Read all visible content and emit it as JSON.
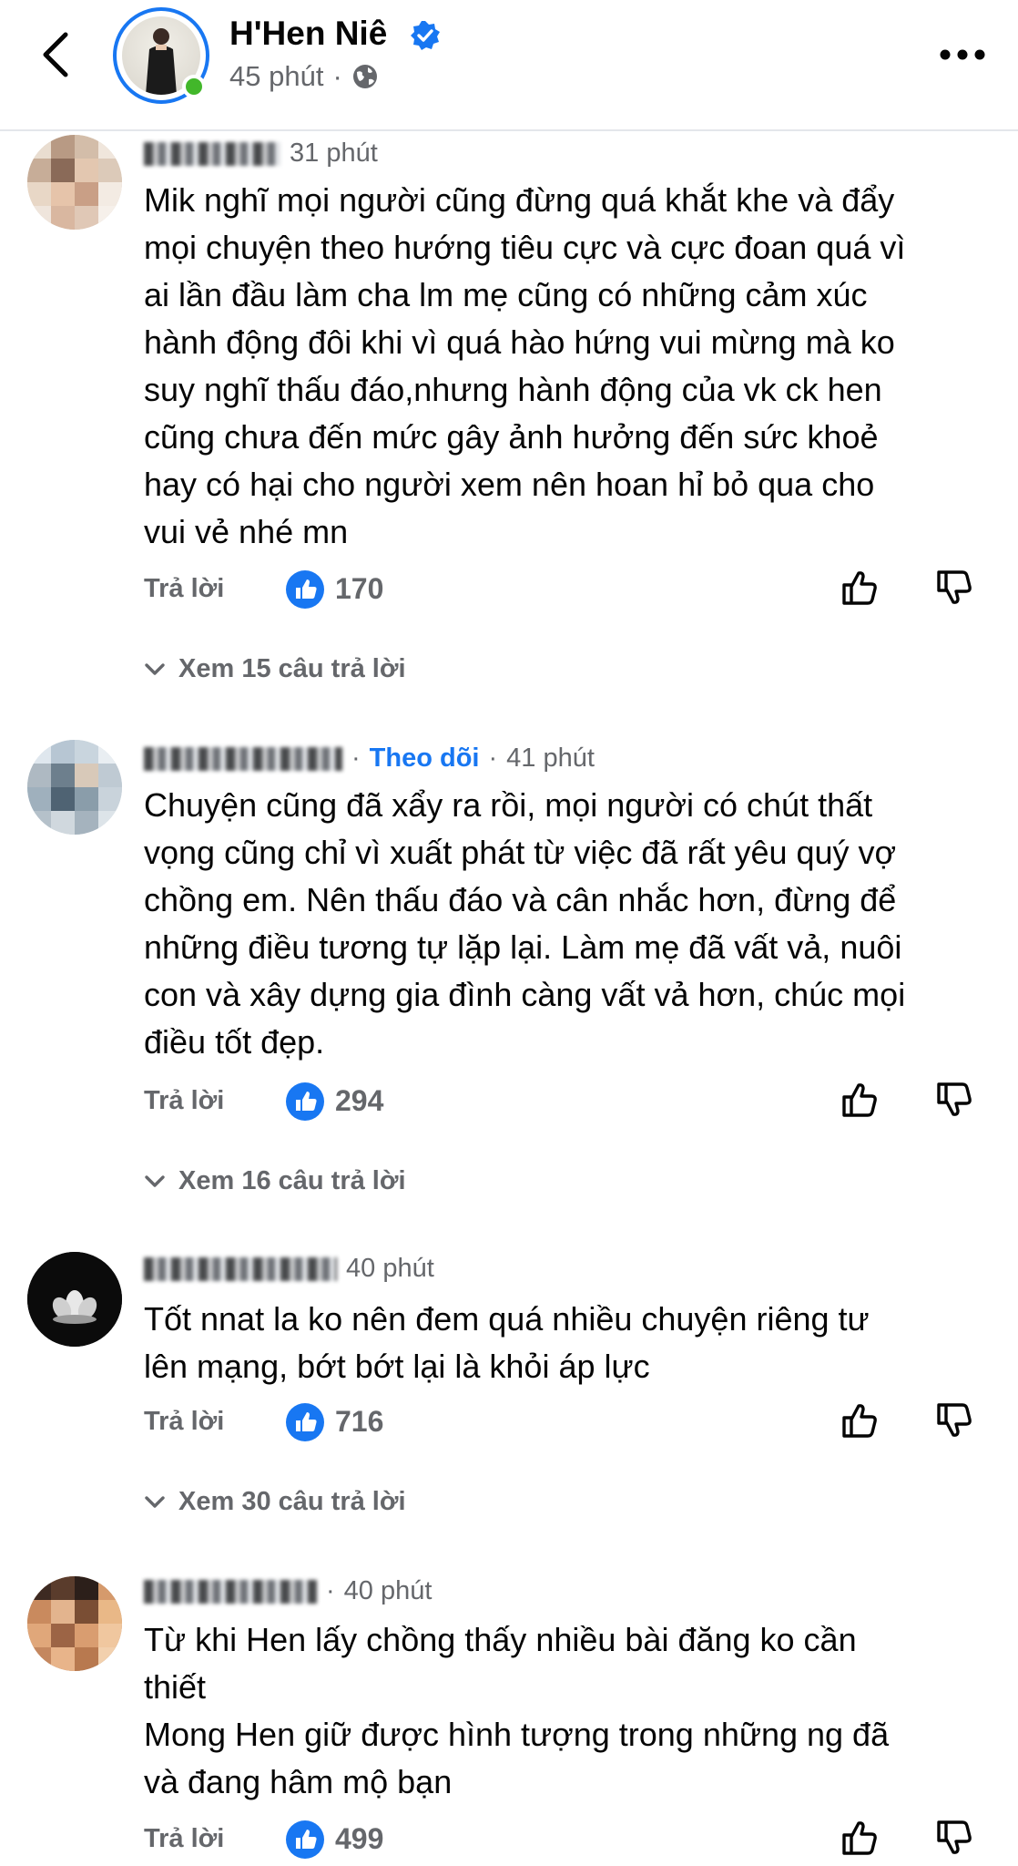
{
  "header": {
    "page_name": "H'Hen Niê",
    "time": "45 phút",
    "separator": "·",
    "icons": {
      "back": "chevron-left-icon",
      "verified": "verified-badge-icon",
      "audience": "globe-icon",
      "more": "more-horizontal-icon"
    }
  },
  "colors": {
    "accent": "#1877f2",
    "secondary_text": "#65676b",
    "online": "#42b72a",
    "text": "#050505"
  },
  "comments": [
    {
      "time": "31 phút",
      "text": "Mik nghĩ mọi người cũng đừng quá khắt khe và đẩy\nmọi chuyện theo hướng tiêu cực và cực đoan quá vì\nai lần đầu làm cha lm mẹ cũng có những cảm xúc\nhành động đôi khi vì quá hào hứng vui mừng mà ko\nsuy nghĩ thấu đáo,nhưng hành động của vk ck hen\ncũng chưa đến mức gây ảnh hưởng đến sức khoẻ\nhay có hại cho người xem nên hoan hỉ bỏ qua cho\nvui vẻ nhé mn",
      "reply_label": "Trả lời",
      "likes": "170",
      "view_replies": "Xem 15 câu trả lời"
    },
    {
      "follow_label": "Theo dõi",
      "separator": "·",
      "time": "41 phút",
      "text": "Chuyện cũng đã xẩy ra rồi, mọi người có chút thất\nvọng cũng chỉ vì xuất phát từ việc đã rất yêu quý vợ\nchồng em. Nên thấu đáo và cân nhắc hơn, đừng để\nnhững điều tương tự lặp lại. Làm mẹ đã vất vả, nuôi\ncon và xây dựng gia đình càng vất vả hơn, chúc mọi\nđiều tốt đẹp.",
      "reply_label": "Trả lời",
      "likes": "294",
      "view_replies": "Xem 16 câu trả lời"
    },
    {
      "time": "40 phút",
      "text": "Tốt nnat la ko nên đem quá nhiều chuyện riêng tư\nlên mạng, bớt bớt lại là khỏi áp lực",
      "reply_label": "Trả lời",
      "likes": "716",
      "view_replies": "Xem 30 câu trả lời"
    },
    {
      "separator": "·",
      "time": "40 phút",
      "text": "Từ khi Hen lấy chồng thấy nhiều bài đăng ko cần\nthiết\nMong Hen giữ được hình tượng trong những ng đã\nvà đang hâm mộ bạn",
      "reply_label": "Trả lời",
      "likes": "499"
    }
  ]
}
